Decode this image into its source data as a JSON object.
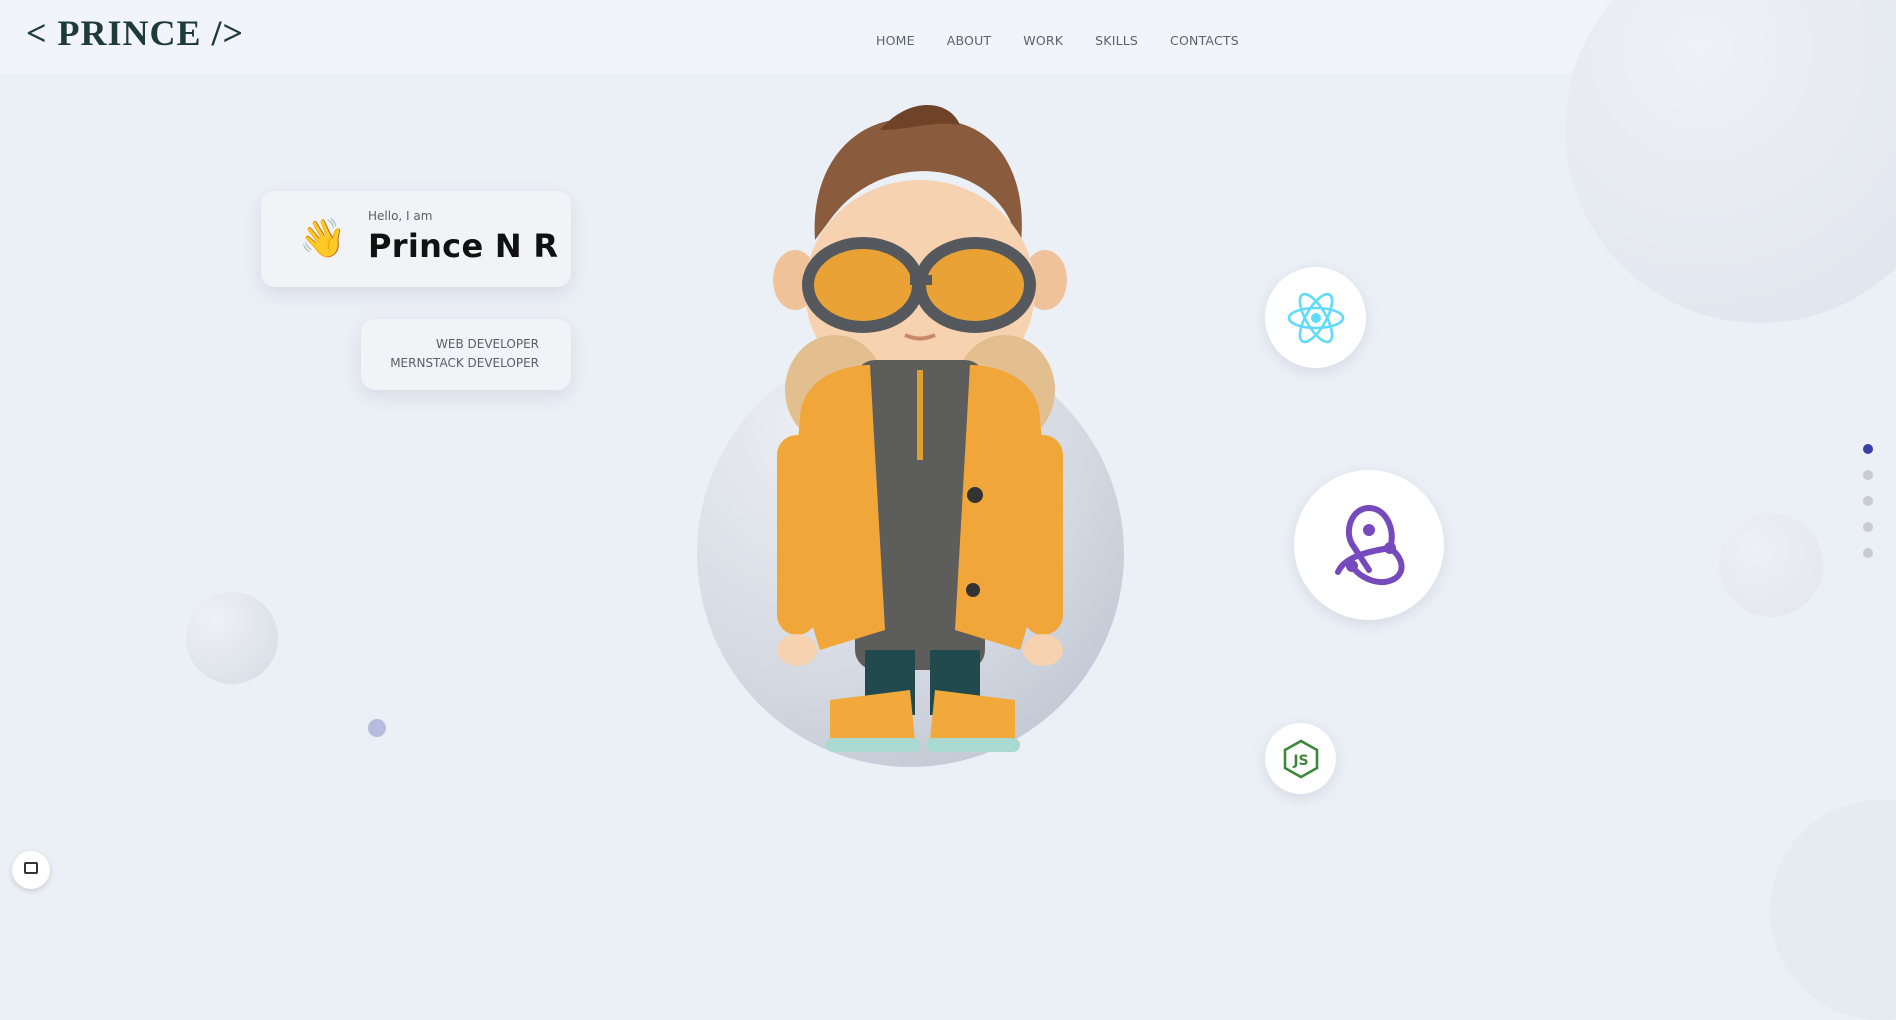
{
  "header": {
    "logo": "< PRINCE />",
    "nav": [
      "HOME",
      "ABOUT",
      "WORK",
      "SKILLS",
      "CONTACTS"
    ]
  },
  "intro": {
    "greeting": "Hello, I am",
    "name": "Prince N R",
    "wave_emoji": "👋",
    "roles": [
      "WEB DEVELOPER",
      "MERNSTACK DEVELOPER"
    ]
  },
  "skills": [
    {
      "icon": "react-icon",
      "color": "#61dafb"
    },
    {
      "icon": "redux-icon",
      "color": "#764abc"
    },
    {
      "icon": "nodejs-icon",
      "color": "#3c873a"
    }
  ],
  "section_dots": {
    "count": 5,
    "active_index": 0
  },
  "colors": {
    "background": "#ebeff6",
    "logo": "#1f3a3a",
    "active_dot": "#3b3fa8",
    "inactive_dot": "#c8cbd2"
  }
}
